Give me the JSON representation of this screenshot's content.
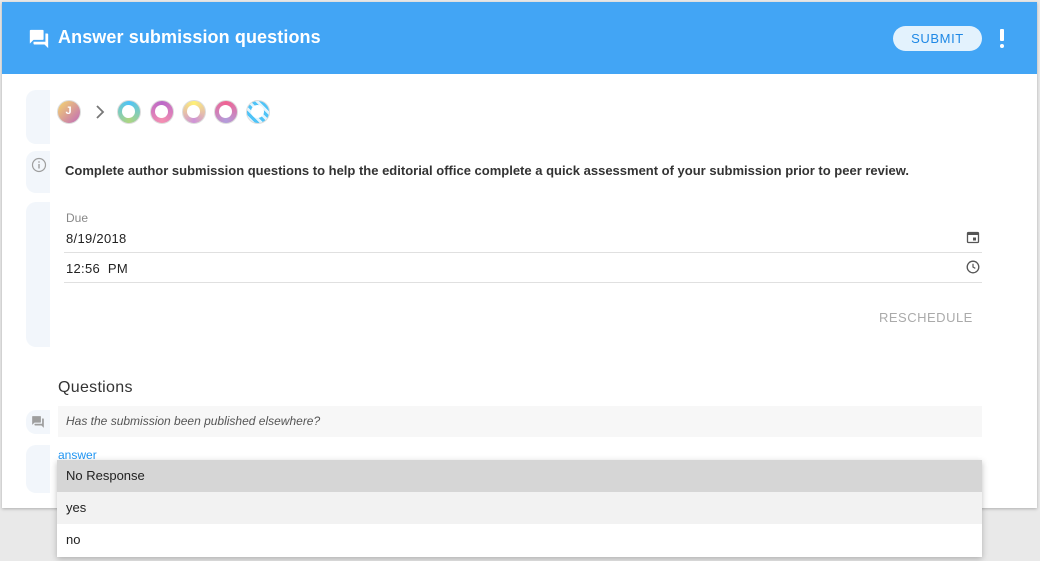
{
  "header": {
    "title": "Answer submission questions",
    "submit_label": "SUBMIT",
    "accent": "#42a5f5"
  },
  "workflow": {
    "avatar_letter": "J",
    "steps": [
      "initial-avatar",
      "submission-icon",
      "edit-icon",
      "search-icon",
      "tools-icon",
      "submission-icon"
    ]
  },
  "info": {
    "text": "Complete author submission questions to help the editorial office complete a quick assessment of your submission prior to peer review."
  },
  "due": {
    "label": "Due",
    "date": "8/19/2018",
    "time": "12:56  PM",
    "reschedule_label": "RESCHEDULE"
  },
  "questions": {
    "heading": "Questions",
    "items": [
      {
        "question": "Has the submission been published elsewhere?",
        "answer_label": "answer",
        "options": [
          "No Response",
          "yes",
          "no"
        ],
        "selected": "No Response"
      }
    ]
  }
}
